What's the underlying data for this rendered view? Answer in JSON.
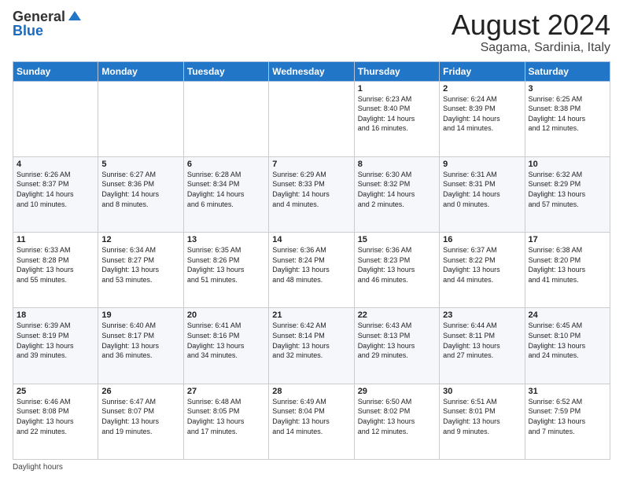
{
  "header": {
    "logo_line1": "General",
    "logo_line2": "Blue",
    "month_title": "August 2024",
    "location": "Sagama, Sardinia, Italy"
  },
  "footer": {
    "daylight_label": "Daylight hours"
  },
  "weekdays": [
    "Sunday",
    "Monday",
    "Tuesday",
    "Wednesday",
    "Thursday",
    "Friday",
    "Saturday"
  ],
  "weeks": [
    [
      {
        "day": "",
        "info": ""
      },
      {
        "day": "",
        "info": ""
      },
      {
        "day": "",
        "info": ""
      },
      {
        "day": "",
        "info": ""
      },
      {
        "day": "1",
        "info": "Sunrise: 6:23 AM\nSunset: 8:40 PM\nDaylight: 14 hours\nand 16 minutes."
      },
      {
        "day": "2",
        "info": "Sunrise: 6:24 AM\nSunset: 8:39 PM\nDaylight: 14 hours\nand 14 minutes."
      },
      {
        "day": "3",
        "info": "Sunrise: 6:25 AM\nSunset: 8:38 PM\nDaylight: 14 hours\nand 12 minutes."
      }
    ],
    [
      {
        "day": "4",
        "info": "Sunrise: 6:26 AM\nSunset: 8:37 PM\nDaylight: 14 hours\nand 10 minutes."
      },
      {
        "day": "5",
        "info": "Sunrise: 6:27 AM\nSunset: 8:36 PM\nDaylight: 14 hours\nand 8 minutes."
      },
      {
        "day": "6",
        "info": "Sunrise: 6:28 AM\nSunset: 8:34 PM\nDaylight: 14 hours\nand 6 minutes."
      },
      {
        "day": "7",
        "info": "Sunrise: 6:29 AM\nSunset: 8:33 PM\nDaylight: 14 hours\nand 4 minutes."
      },
      {
        "day": "8",
        "info": "Sunrise: 6:30 AM\nSunset: 8:32 PM\nDaylight: 14 hours\nand 2 minutes."
      },
      {
        "day": "9",
        "info": "Sunrise: 6:31 AM\nSunset: 8:31 PM\nDaylight: 14 hours\nand 0 minutes."
      },
      {
        "day": "10",
        "info": "Sunrise: 6:32 AM\nSunset: 8:29 PM\nDaylight: 13 hours\nand 57 minutes."
      }
    ],
    [
      {
        "day": "11",
        "info": "Sunrise: 6:33 AM\nSunset: 8:28 PM\nDaylight: 13 hours\nand 55 minutes."
      },
      {
        "day": "12",
        "info": "Sunrise: 6:34 AM\nSunset: 8:27 PM\nDaylight: 13 hours\nand 53 minutes."
      },
      {
        "day": "13",
        "info": "Sunrise: 6:35 AM\nSunset: 8:26 PM\nDaylight: 13 hours\nand 51 minutes."
      },
      {
        "day": "14",
        "info": "Sunrise: 6:36 AM\nSunset: 8:24 PM\nDaylight: 13 hours\nand 48 minutes."
      },
      {
        "day": "15",
        "info": "Sunrise: 6:36 AM\nSunset: 8:23 PM\nDaylight: 13 hours\nand 46 minutes."
      },
      {
        "day": "16",
        "info": "Sunrise: 6:37 AM\nSunset: 8:22 PM\nDaylight: 13 hours\nand 44 minutes."
      },
      {
        "day": "17",
        "info": "Sunrise: 6:38 AM\nSunset: 8:20 PM\nDaylight: 13 hours\nand 41 minutes."
      }
    ],
    [
      {
        "day": "18",
        "info": "Sunrise: 6:39 AM\nSunset: 8:19 PM\nDaylight: 13 hours\nand 39 minutes."
      },
      {
        "day": "19",
        "info": "Sunrise: 6:40 AM\nSunset: 8:17 PM\nDaylight: 13 hours\nand 36 minutes."
      },
      {
        "day": "20",
        "info": "Sunrise: 6:41 AM\nSunset: 8:16 PM\nDaylight: 13 hours\nand 34 minutes."
      },
      {
        "day": "21",
        "info": "Sunrise: 6:42 AM\nSunset: 8:14 PM\nDaylight: 13 hours\nand 32 minutes."
      },
      {
        "day": "22",
        "info": "Sunrise: 6:43 AM\nSunset: 8:13 PM\nDaylight: 13 hours\nand 29 minutes."
      },
      {
        "day": "23",
        "info": "Sunrise: 6:44 AM\nSunset: 8:11 PM\nDaylight: 13 hours\nand 27 minutes."
      },
      {
        "day": "24",
        "info": "Sunrise: 6:45 AM\nSunset: 8:10 PM\nDaylight: 13 hours\nand 24 minutes."
      }
    ],
    [
      {
        "day": "25",
        "info": "Sunrise: 6:46 AM\nSunset: 8:08 PM\nDaylight: 13 hours\nand 22 minutes."
      },
      {
        "day": "26",
        "info": "Sunrise: 6:47 AM\nSunset: 8:07 PM\nDaylight: 13 hours\nand 19 minutes."
      },
      {
        "day": "27",
        "info": "Sunrise: 6:48 AM\nSunset: 8:05 PM\nDaylight: 13 hours\nand 17 minutes."
      },
      {
        "day": "28",
        "info": "Sunrise: 6:49 AM\nSunset: 8:04 PM\nDaylight: 13 hours\nand 14 minutes."
      },
      {
        "day": "29",
        "info": "Sunrise: 6:50 AM\nSunset: 8:02 PM\nDaylight: 13 hours\nand 12 minutes."
      },
      {
        "day": "30",
        "info": "Sunrise: 6:51 AM\nSunset: 8:01 PM\nDaylight: 13 hours\nand 9 minutes."
      },
      {
        "day": "31",
        "info": "Sunrise: 6:52 AM\nSunset: 7:59 PM\nDaylight: 13 hours\nand 7 minutes."
      }
    ]
  ]
}
